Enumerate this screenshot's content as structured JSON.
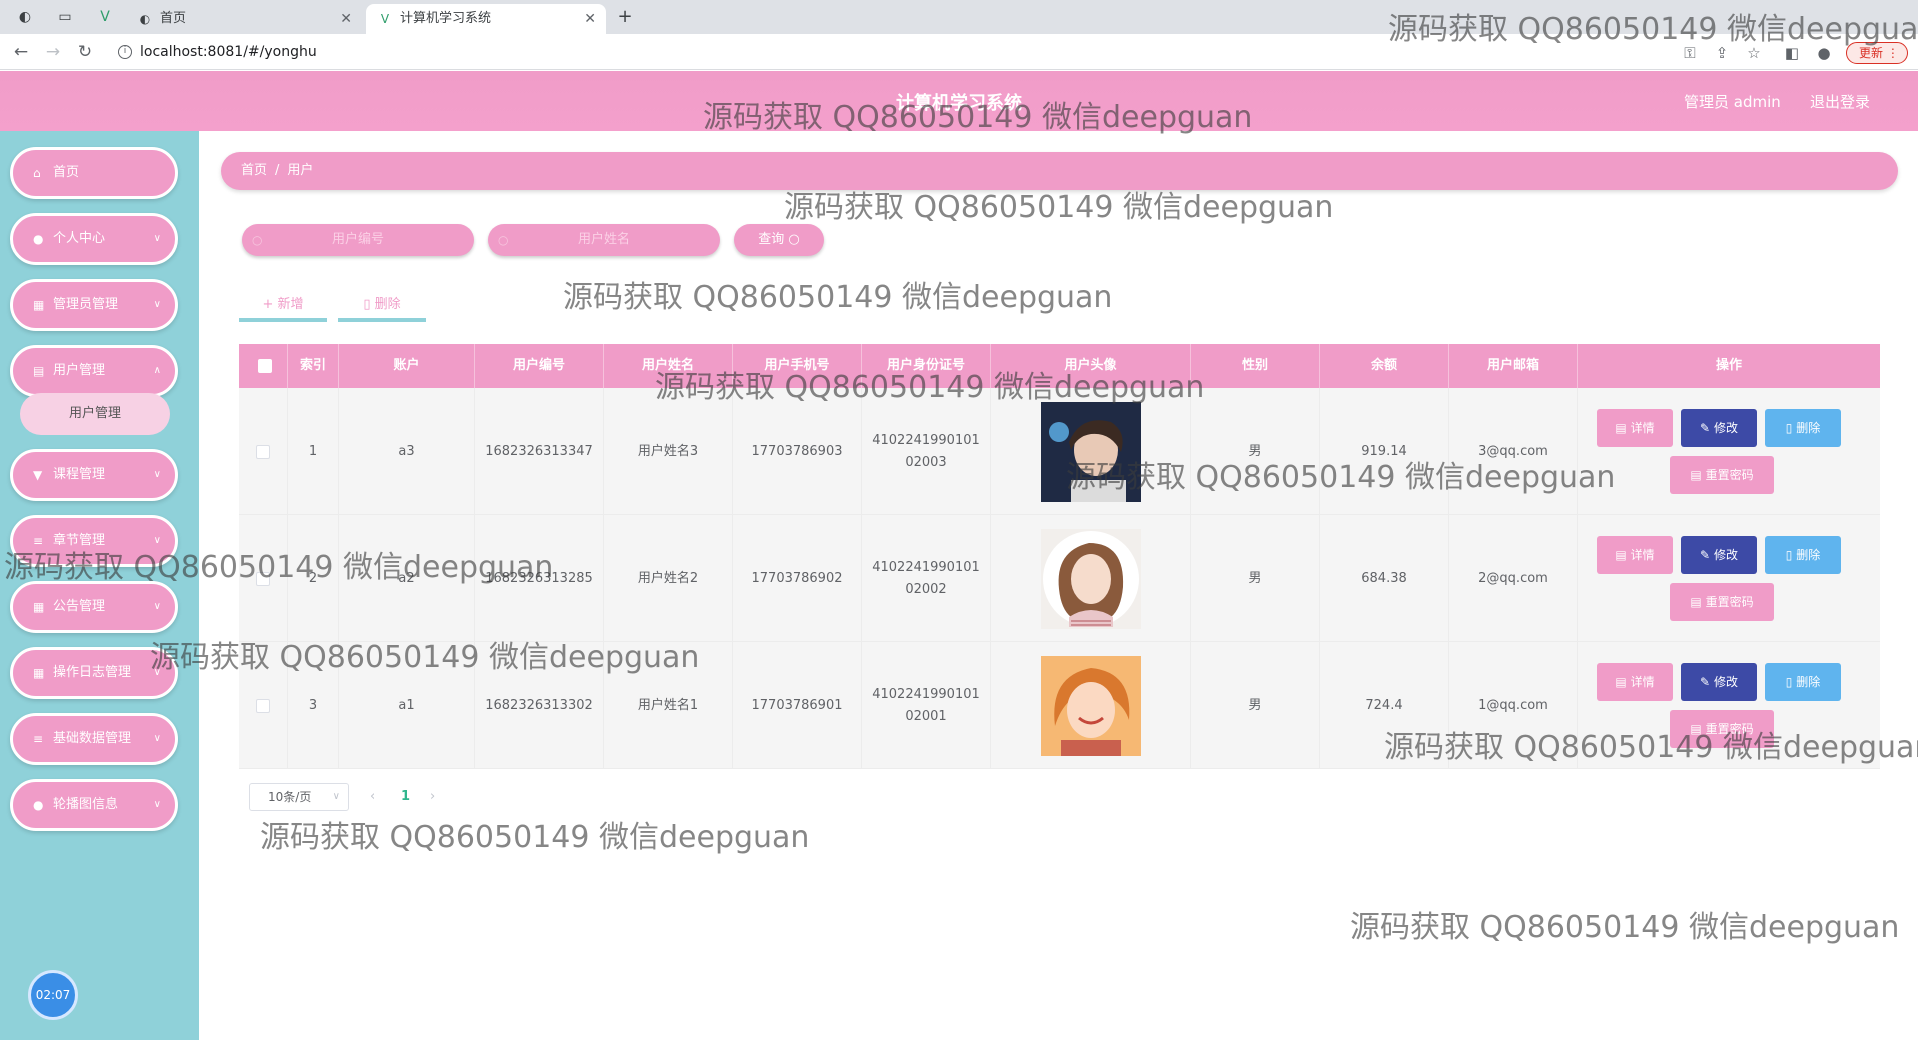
{
  "browser": {
    "tabs": [
      {
        "title": "首页"
      },
      {
        "title": "计算机学习系统"
      }
    ],
    "url": "localhost:8081/#/yonghu",
    "update_label": "更新"
  },
  "header": {
    "title": "计算机学习系统",
    "admin_label": "管理员 admin",
    "logout_label": "退出登录"
  },
  "sidebar": {
    "items": [
      {
        "label": "首页",
        "icon": "home-icon"
      },
      {
        "label": "个人中心",
        "icon": "user-icon"
      },
      {
        "label": "管理员管理",
        "icon": "grid-icon"
      },
      {
        "label": "用户管理",
        "icon": "doc-icon"
      },
      {
        "label": "课程管理",
        "icon": "cup-icon"
      },
      {
        "label": "章节管理",
        "icon": "menu-icon"
      },
      {
        "label": "公告管理",
        "icon": "grid-icon"
      },
      {
        "label": "操作日志管理",
        "icon": "grid-icon"
      },
      {
        "label": "基础数据管理",
        "icon": "menu-icon"
      },
      {
        "label": "轮播图信息",
        "icon": "bulb-icon"
      }
    ],
    "submenu_active": "用户管理",
    "clock": "02:07"
  },
  "breadcrumb": [
    "首页",
    "/",
    "用户"
  ],
  "search": {
    "number_placeholder": "用户编号",
    "name_placeholder": "用户姓名",
    "button_label": "查询"
  },
  "actions": {
    "add_label": "新增",
    "delete_label": "删除"
  },
  "table": {
    "columns": [
      "索引",
      "账户",
      "用户编号",
      "用户姓名",
      "用户手机号",
      "用户身份证号",
      "用户头像",
      "性别",
      "余额",
      "用户邮箱",
      "操作"
    ],
    "rows": [
      {
        "index": "1",
        "account": "a3",
        "number": "1682326313347",
        "name": "用户姓名3",
        "phone": "17703786903",
        "id_card_1": "4102241990101",
        "id_card_2": "02003",
        "gender": "男",
        "balance": "919.14",
        "email": "3@qq.com"
      },
      {
        "index": "2",
        "account": "a2",
        "number": "1682326313285",
        "name": "用户姓名2",
        "phone": "17703786902",
        "id_card_1": "4102241990101",
        "id_card_2": "02002",
        "gender": "男",
        "balance": "684.38",
        "email": "2@qq.com"
      },
      {
        "index": "3",
        "account": "a1",
        "number": "1682326313302",
        "name": "用户姓名1",
        "phone": "17703786901",
        "id_card_1": "4102241990101",
        "id_card_2": "02001",
        "gender": "男",
        "balance": "724.4",
        "email": "1@qq.com"
      }
    ],
    "op_labels": {
      "detail": "详情",
      "edit": "修改",
      "delete": "删除",
      "reset": "重置密码"
    }
  },
  "pagination": {
    "page_size": "10条/页",
    "current_page": "1"
  },
  "watermark": "源码获取 QQ86050149 微信deepguan"
}
